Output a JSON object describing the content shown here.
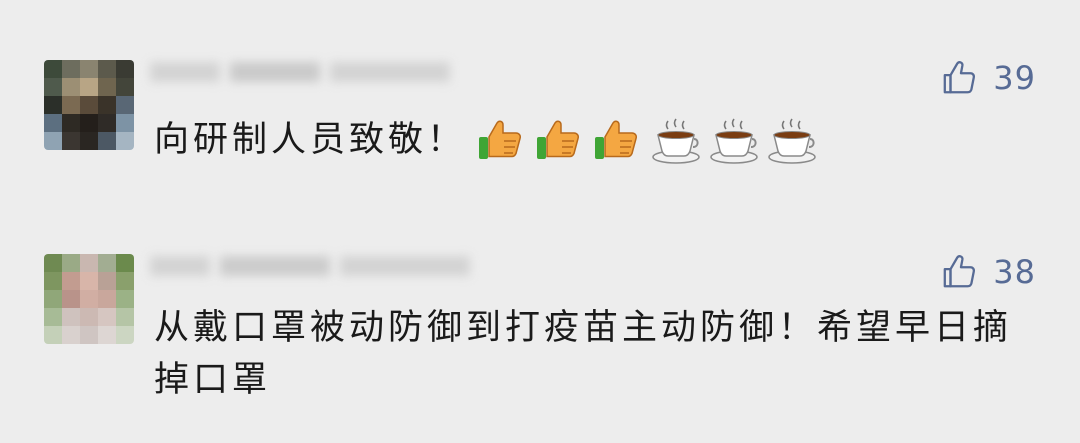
{
  "comments": [
    {
      "text": "向研制人员致敬！",
      "likes": "39",
      "emojis": [
        "thumbs-up",
        "thumbs-up",
        "thumbs-up",
        "coffee",
        "coffee",
        "coffee"
      ]
    },
    {
      "text": "从戴口罩被动防御到打疫苗主动防御！希望早日摘掉口罩",
      "likes": "38",
      "emojis": []
    }
  ],
  "colors": {
    "background": "#ededed",
    "like": "#576b95",
    "text": "#1a1a1a"
  },
  "icons": {
    "like": "thumbs-up-outline-icon"
  }
}
